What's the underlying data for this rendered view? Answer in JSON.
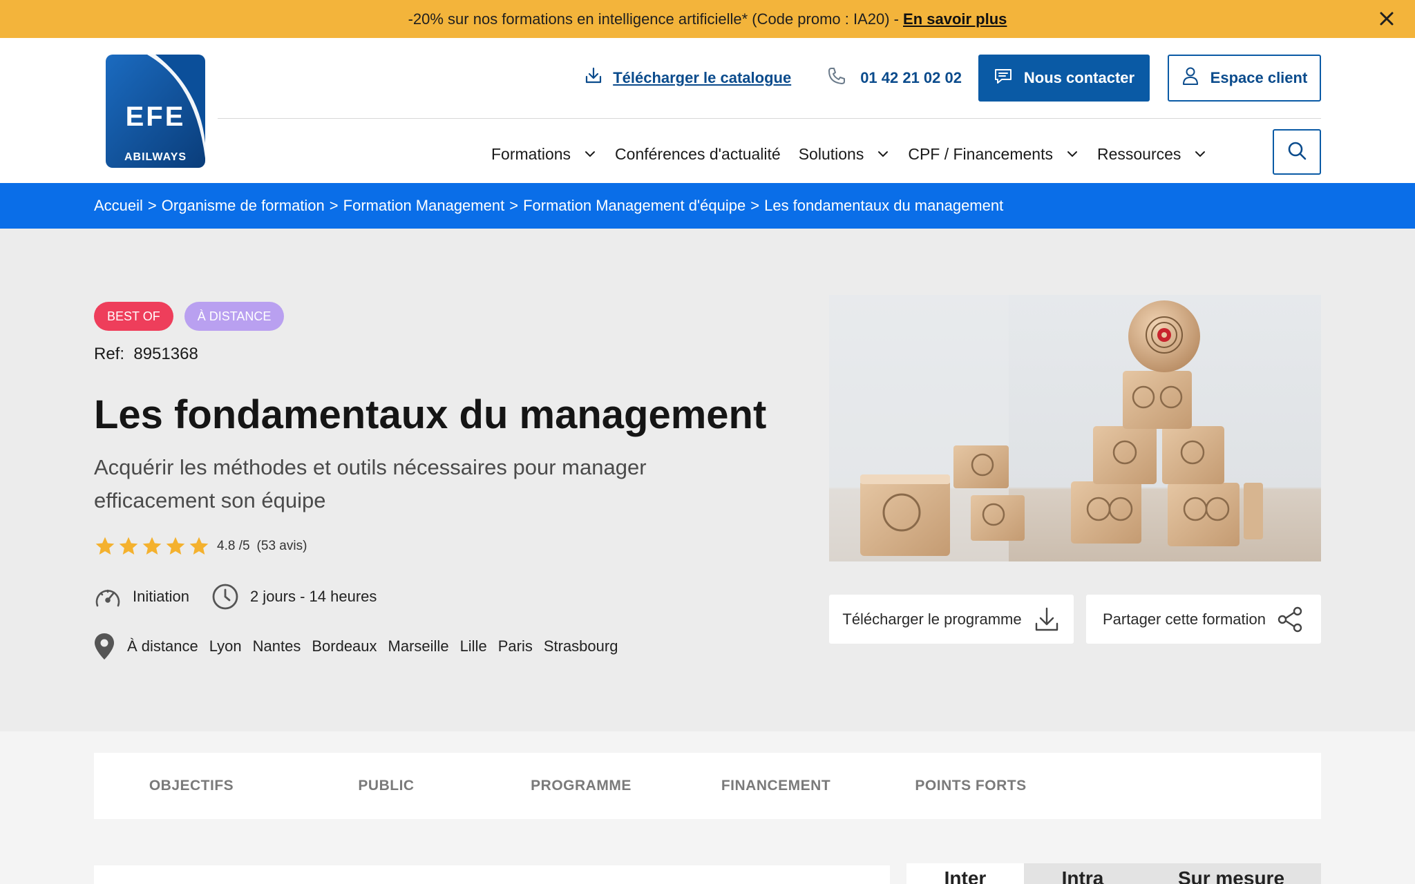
{
  "promo": {
    "text": "-20% sur nos formations en intelligence artificielle* (Code promo : IA20) -",
    "link": "En savoir plus",
    "close_icon": "close-icon"
  },
  "header": {
    "logo_main": "EFE",
    "logo_sub": "ABILWAYS",
    "catalog_label": "Télécharger le catalogue",
    "phone": "01 42 21 02 02",
    "contact_label": "Nous contacter",
    "client_label": "Espace client",
    "colors": {
      "primary": "#0a5aa5",
      "promo": "#f3b43b",
      "breadcrumb": "#0a6ee8"
    }
  },
  "nav": {
    "items": [
      {
        "label": "Formations",
        "has_dropdown": true
      },
      {
        "label": "Conférences d'actualité",
        "has_dropdown": false
      },
      {
        "label": "Solutions",
        "has_dropdown": true
      },
      {
        "label": "CPF / Financements",
        "has_dropdown": true
      },
      {
        "label": "Ressources",
        "has_dropdown": true
      }
    ]
  },
  "breadcrumb": {
    "items": [
      "Accueil",
      "Organisme de formation",
      "Formation Management",
      "Formation Management d'équipe",
      "Les fondamentaux du management"
    ],
    "separator": ">"
  },
  "course": {
    "badges": [
      "BEST OF",
      "À DISTANCE"
    ],
    "ref_label": "Ref:",
    "ref_value": "8951368",
    "title": "Les fondamentaux du management",
    "subtitle": "Acquérir les méthodes et outils nécessaires pour manager efficacement son équipe",
    "rating": {
      "stars": 4.8,
      "text": "4.8 /5",
      "reviews": "(53 avis)"
    },
    "level": "Initiation",
    "duration": "2 jours - 14 heures",
    "locations": [
      "À distance",
      "Lyon",
      "Nantes",
      "Bordeaux",
      "Marseille",
      "Lille",
      "Paris",
      "Strasbourg"
    ],
    "download_program": "Télécharger le programme",
    "share": "Partager cette formation"
  },
  "tabs": [
    "OBJECTIFS",
    "PUBLIC",
    "PROGRAMME",
    "FINANCEMENT",
    "POINTS FORTS"
  ],
  "price_tabs": [
    "Inter",
    "Intra",
    "Sur mesure"
  ]
}
